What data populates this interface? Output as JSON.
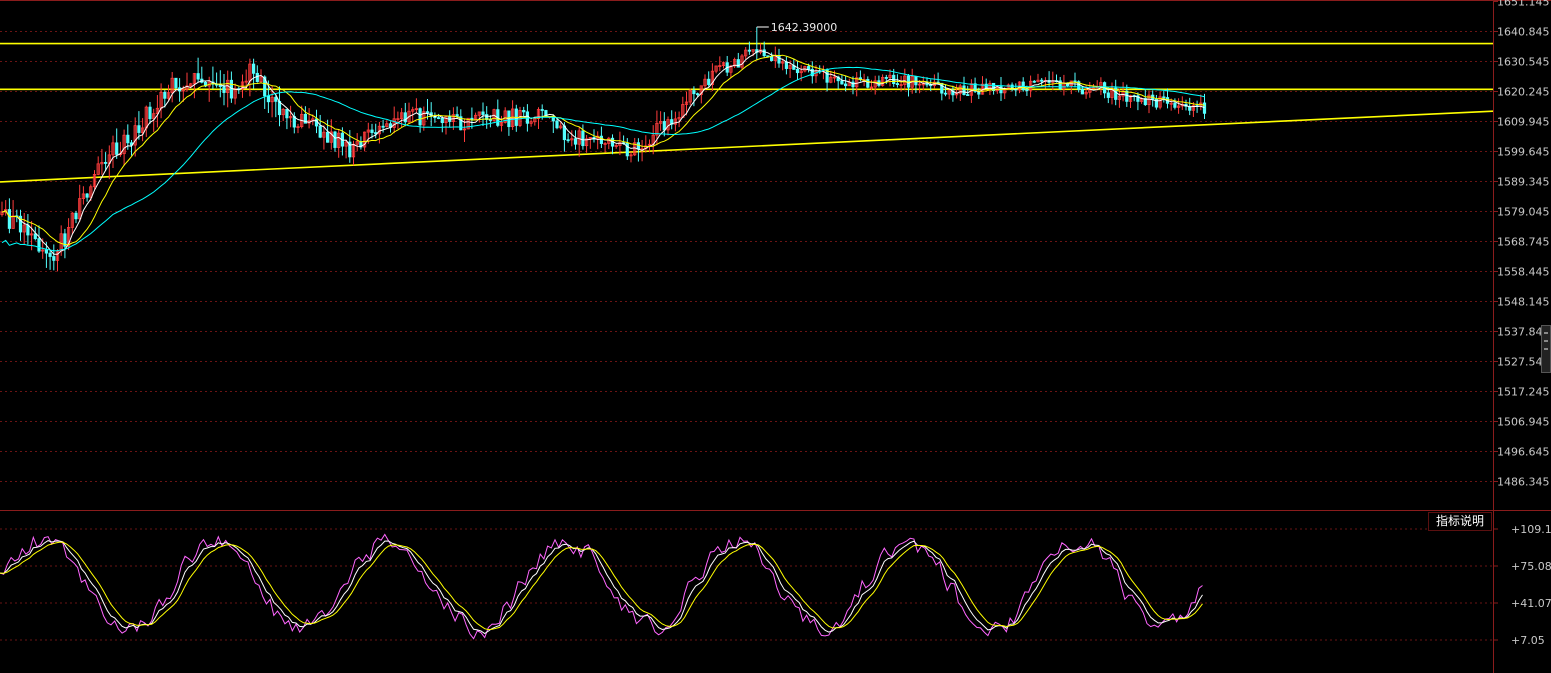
{
  "chart_data": [
    {
      "type": "candlestick",
      "panel": "price",
      "ylim": [
        1480,
        1651.145
      ],
      "y_ticks": [
        "1651.145",
        "1640.845",
        "1630.545",
        "1620.245",
        "1609.945",
        "1599.645",
        "1589.345",
        "1579.045",
        "1568.745",
        "1558.445",
        "1548.145",
        "1537.84",
        "1527.54",
        "1517.245",
        "1506.945",
        "1496.645",
        "1486.345"
      ],
      "grid": true,
      "annotations": [
        {
          "label": "1642.39000",
          "y": 1642.39
        }
      ],
      "horizontal_lines": [
        1636.7,
        1621.0
      ],
      "trendline": {
        "start": 1589.2,
        "end": 1613.5
      },
      "price_range": {
        "low": 1556.0,
        "high": 1642.39
      }
    },
    {
      "type": "line",
      "panel": "indicator",
      "ylim": [
        0,
        114
      ],
      "y_ticks": [
        "+109.1",
        "+75.08",
        "+41.07",
        "+7.05"
      ],
      "series_count": 3,
      "grid": true
    }
  ],
  "indicator_button": "指标说明",
  "colors": {
    "background": "#000000",
    "grid": "#6a1414",
    "axis_label": "#c8c8c8",
    "up": "#ff3c3c",
    "down": "#54ffff",
    "level_line": "#ffff00",
    "ma_short": "#ffffff",
    "ma_mid": "#ffff00",
    "ma_long": "#00ffff",
    "indicator_fast": "#ff66ff",
    "indicator_mid": "#ffffff",
    "indicator_slow": "#ffff00"
  }
}
